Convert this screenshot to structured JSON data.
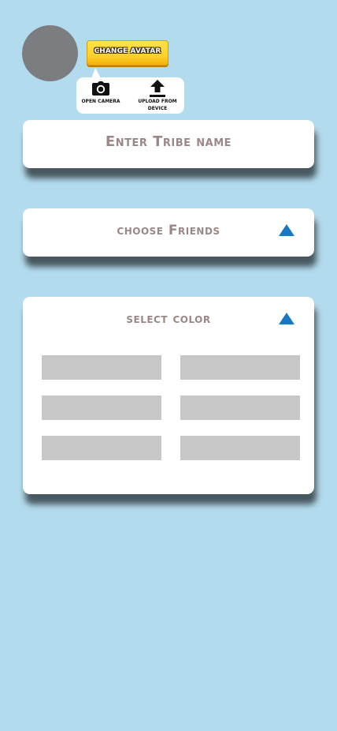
{
  "avatar": {
    "change_button_label": "Change Avatar",
    "menu": {
      "open_camera_label": "Open camera",
      "upload_label": "Upload from device"
    }
  },
  "tribe_name": {
    "placeholder": "Enter Tribe name"
  },
  "friends": {
    "heading": "choose Friends"
  },
  "color": {
    "heading": "select color",
    "swatches": [
      "#c7c7c7",
      "#c7c7c7",
      "#c7c7c7",
      "#c7c7c7",
      "#c7c7c7",
      "#c7c7c7"
    ]
  },
  "theme": {
    "background": "#b3dbee",
    "card": "#ffffff",
    "heading_text": "#9a8787",
    "accent": "#1779c4",
    "avatar_placeholder": "#7c7d81",
    "button_yellow": "#fdd22e"
  }
}
